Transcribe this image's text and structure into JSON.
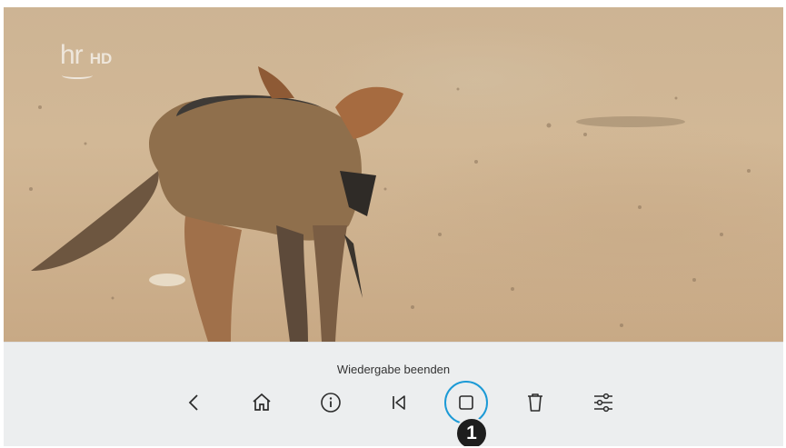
{
  "channel": {
    "logo_text": "hr",
    "quality": "HD"
  },
  "controls": {
    "tooltip": "Wiedergabe beenden",
    "buttons": [
      {
        "id": "back",
        "icon": "chevron-left-icon"
      },
      {
        "id": "home",
        "icon": "home-icon"
      },
      {
        "id": "info",
        "icon": "info-icon"
      },
      {
        "id": "skip-back",
        "icon": "skip-back-icon"
      },
      {
        "id": "stop",
        "icon": "stop-icon",
        "focused": true
      },
      {
        "id": "delete",
        "icon": "trash-icon"
      },
      {
        "id": "settings",
        "icon": "sliders-icon"
      }
    ],
    "accent_color": "#1c9ad6"
  },
  "annotation": {
    "badge_number": "1"
  }
}
